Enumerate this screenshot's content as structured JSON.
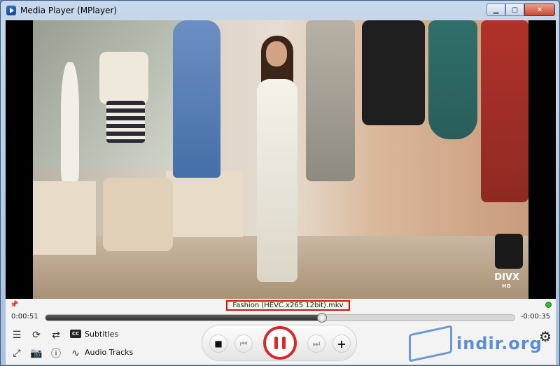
{
  "window": {
    "title": "Media Player (MPlayer)",
    "minimize": "▁",
    "maximize": "▢",
    "close": "✕"
  },
  "video": {
    "logo_main": "DIVX",
    "logo_sub": "HD"
  },
  "playback": {
    "filename": "Fashion (HEVC x265 12bit).mkv",
    "elapsed": "0:00:51",
    "remaining": "-0:00:35",
    "progress_fraction": 0.59,
    "status_color": "#3ab53a"
  },
  "buttons": {
    "subtitles": "Subtitles",
    "audio_tracks": "Audio Tracks",
    "stop": "■",
    "prev": "⏮",
    "next": "⏭",
    "add": "+"
  },
  "watermark": {
    "text": "indir.org"
  },
  "colors": {
    "accent_red": "#d92828",
    "title_bar": "#c7d8ec",
    "watermark_blue": "#5b8fd0"
  }
}
